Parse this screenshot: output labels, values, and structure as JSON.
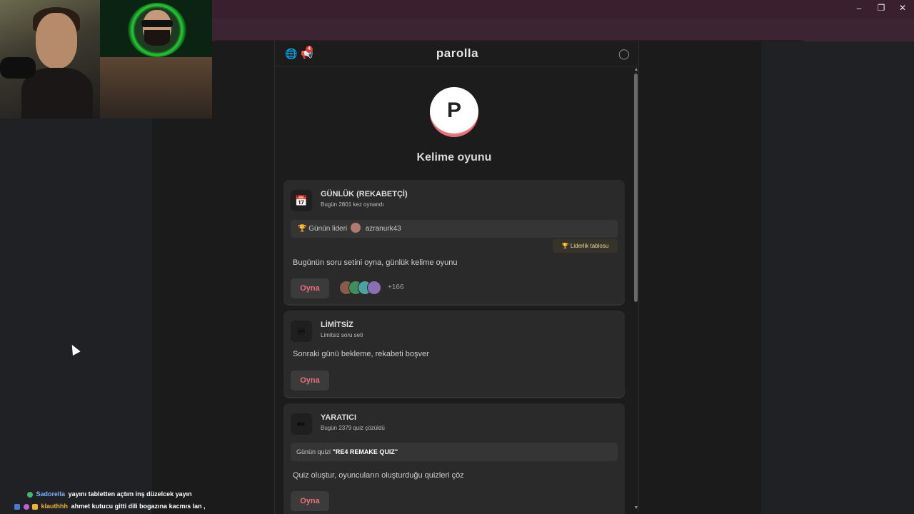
{
  "app": {
    "logo": "parolla",
    "notification_count": "4",
    "big_logo_letter": "P",
    "tagline": "Kelime oyunu",
    "cards": [
      {
        "icon": "calendar-icon",
        "title": "GÜNLÜK (REKABETÇİ)",
        "subtitle": "Bugün 2801 kez oynandı",
        "leader_label": "Günün lideri",
        "leader_name": "azranurk43",
        "leaderboard_button": "Liderlik tablosu",
        "description": "Bugünün soru setini oyna, günlük kelime oyunu",
        "play_label": "Oyna",
        "players_more": "+166"
      },
      {
        "icon": "infinity-icon",
        "title": "LİMİTSİZ",
        "subtitle": "Limitsiz soru seti",
        "description": "Sonraki günü bekleme, rekabeti boşver",
        "play_label": "Oyna"
      },
      {
        "icon": "pencil-icon",
        "title": "YARATICI",
        "subtitle": "Bugün 2379 quiz çözüldü",
        "quiz_label": "Günün quizi",
        "quiz_name": "\"RE4 REMAKE QUIZ\"",
        "description": "Quiz oluştur, oyuncuların oluşturduğu quizleri çöz",
        "play_label": "Oyna"
      }
    ]
  },
  "chat": [
    {
      "name": "Sadorella",
      "name_color": "#7fb2ff",
      "message": "yayını tabletten açtım inş düzelcek yayın"
    },
    {
      "name": "klauthhh",
      "name_color": "#f0b429",
      "message": "ahmet kutucu gitti dili bogazına kacmıs lan ,"
    }
  ],
  "colors": {
    "accent": "#e8707a",
    "app_bg": "#1c1c1c",
    "card_bg": "#2a2a2a",
    "browser_frame": "#3a1f2e"
  }
}
